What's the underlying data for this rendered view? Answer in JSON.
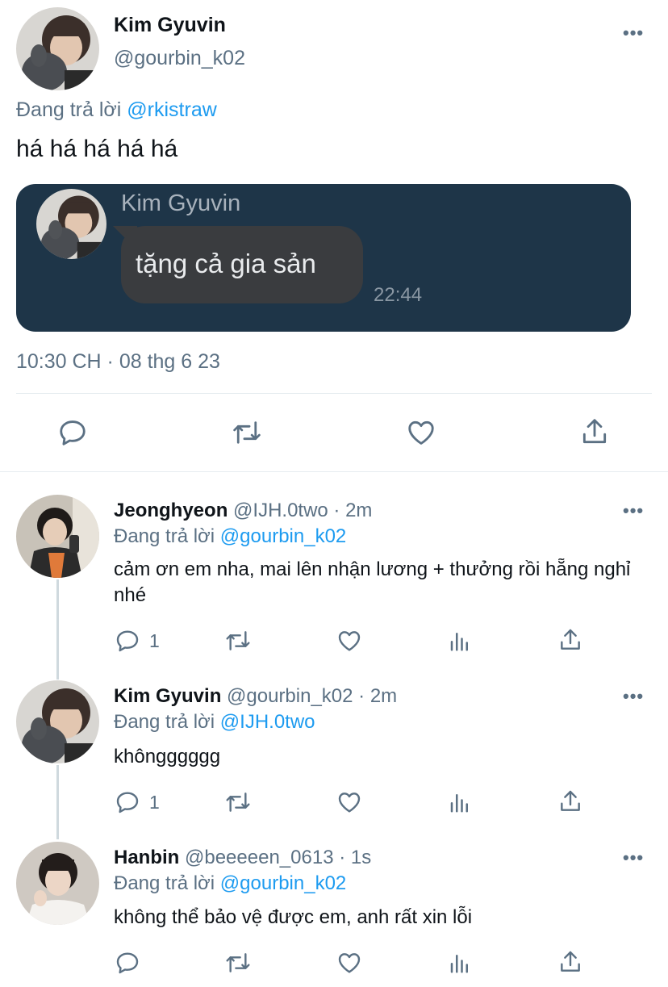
{
  "main_tweet": {
    "name": "Kim Gyuvin",
    "handle": "@gourbin_k02",
    "replying_prefix": "Đang trả lời",
    "replying_to": "@rkistraw",
    "text": "há há há há há",
    "media": {
      "name": "Kim Gyuvin",
      "message": "tặng cả gia sản",
      "time": "22:44"
    },
    "timestamp": "10:30 CH · 08 thg 6 23"
  },
  "replies": [
    {
      "name": "Jeonghyeon",
      "meta": "@IJH.0two · 2m",
      "replying_prefix": "Đang trả lời",
      "replying_to": "@gourbin_k02",
      "text": "cảm ơn em nha, mai lên nhận lương + thưởng rồi hẵng nghỉ nhé",
      "reply_count": "1"
    },
    {
      "name": "Kim Gyuvin",
      "meta": "@gourbin_k02 · 2m",
      "replying_prefix": "Đang trả lời",
      "replying_to": "@IJH.0two",
      "text": "khôngggggg",
      "reply_count": "1"
    },
    {
      "name": "Hanbin",
      "meta": "@beeeeen_0613 · 1s",
      "replying_prefix": "Đang trả lời",
      "replying_to": "@gourbin_k02",
      "text": "không thể bảo vệ được em, anh rất xin lỗi",
      "reply_count": ""
    }
  ],
  "icons": [
    "reply-icon",
    "retweet-icon",
    "like-icon",
    "analytics-icon",
    "share-icon",
    "more-icon"
  ],
  "colors": {
    "link": "#1d9bf0",
    "muted": "#5b7083",
    "media_bg": "#1e3548"
  }
}
